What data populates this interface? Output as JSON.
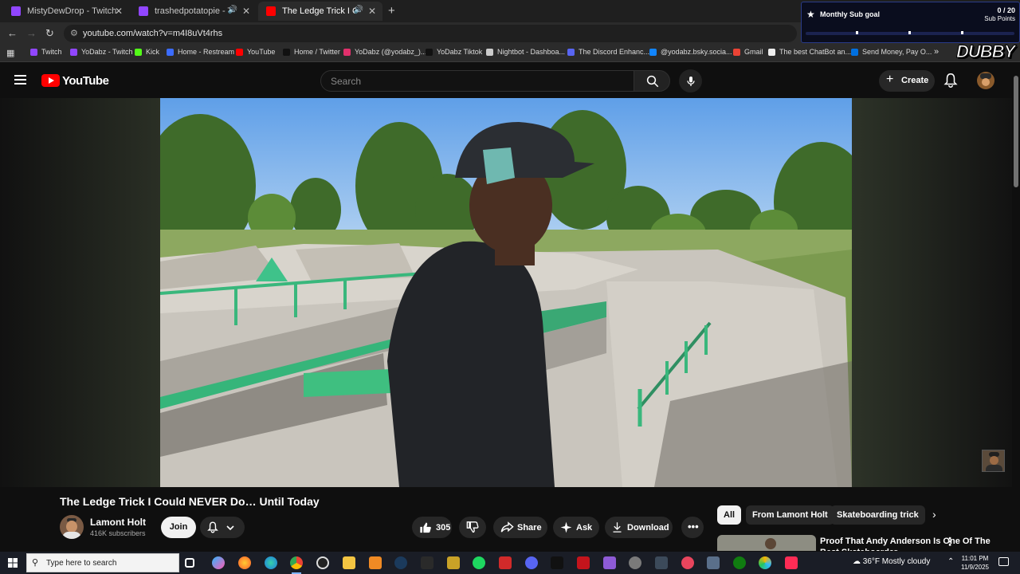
{
  "browser": {
    "tabs": [
      {
        "title": "MistyDewDrop - Twitch",
        "favicon_color": "#9146ff",
        "active": false,
        "audio": false
      },
      {
        "title": "trashedpotatopie - Twitch",
        "favicon_color": "#9146ff",
        "active": false,
        "audio": true
      },
      {
        "title": "The Ledge Trick I Could NEVER Do... Until Today",
        "favicon_color": "#ff0000",
        "active": true,
        "audio": true
      }
    ],
    "url": "youtube.com/watch?v=m4I8uVt4rhs",
    "bookmarks": [
      {
        "label": "Twitch",
        "icon": "twitch-icon",
        "color": "#9146ff"
      },
      {
        "label": "YoDabz - Twitch",
        "icon": "twitch-icon",
        "color": "#9146ff"
      },
      {
        "label": "Kick",
        "icon": "kick-icon",
        "color": "#53fc18"
      },
      {
        "label": "Home - Restream",
        "icon": "restream-icon",
        "color": "#3b6cff"
      },
      {
        "label": "YouTube",
        "icon": "youtube-icon",
        "color": "#ff0000"
      },
      {
        "label": "Home / Twitter",
        "icon": "x-icon",
        "color": "#111111"
      },
      {
        "label": "YoDabz (@yodabz_)...",
        "icon": "instagram-icon",
        "color": "#e1306c"
      },
      {
        "label": "YoDabz Tiktok",
        "icon": "tiktok-icon",
        "color": "#111111"
      },
      {
        "label": "Nightbot - Dashboa...",
        "icon": "nightbot-icon",
        "color": "#cccccc"
      },
      {
        "label": "The Discord Enhanc...",
        "icon": "discord-icon",
        "color": "#5865f2"
      },
      {
        "label": "@yodabz.bsky.socia...",
        "icon": "bluesky-icon",
        "color": "#1185fe"
      },
      {
        "label": "Gmail",
        "icon": "gmail-icon",
        "color": "#ea4335"
      },
      {
        "label": "The best ChatBot an...",
        "icon": "chatbot-icon",
        "color": "#eeeeee"
      },
      {
        "label": "Send Money, Pay O...",
        "icon": "paypal-icon",
        "color": "#0070e0"
      }
    ]
  },
  "overlay": {
    "goal_title": "Monthly Sub goal",
    "goal_count": "0 / 20",
    "goal_unit": "Sub Points",
    "goal_progress": 0,
    "brand": "DUBBY"
  },
  "youtube": {
    "logo_text": "YouTube",
    "search_placeholder": "Search",
    "create_label": "Create",
    "video_title": "The Ledge Trick I Could NEVER Do… Until Today",
    "channel_name": "Lamont Holt",
    "subscribers": "416K subscribers",
    "join_label": "Join",
    "likes": "305",
    "share_label": "Share",
    "ask_label": "Ask",
    "download_label": "Download",
    "chips": [
      "All",
      "From Lamont Holt",
      "Skateboarding trick"
    ],
    "recommended_title": "Proof That Andy Anderson Is One Of The Best Skateboarder"
  },
  "taskbar": {
    "search_placeholder": "Type here to search",
    "weather": "36°F  Mostly cloudy",
    "time": "11:01 PM",
    "date": "11/9/2025"
  }
}
